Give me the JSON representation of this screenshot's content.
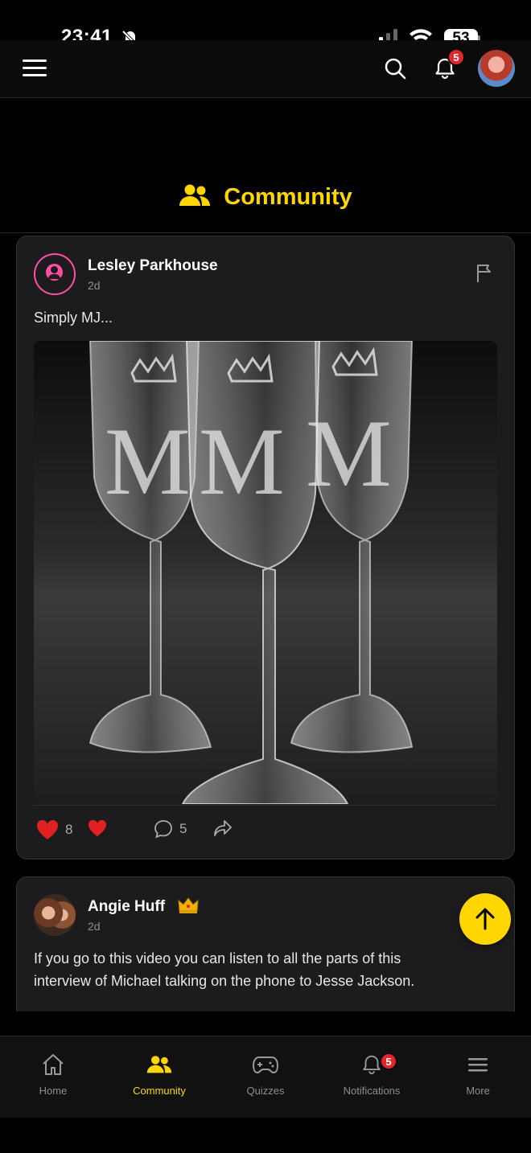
{
  "status_bar": {
    "time": "23:41",
    "battery": "53"
  },
  "header": {
    "notification_count": "5",
    "icons": [
      "menu-icon",
      "search-icon",
      "bell-icon",
      "avatar"
    ]
  },
  "page": {
    "title": "Community",
    "title_icon": "users-icon",
    "accent_color": "#ffd600"
  },
  "posts": [
    {
      "author": "Lesley Parkhouse",
      "time": "2d",
      "text": "Simply MJ...",
      "image_alt": "Three engraved champagne flutes with MJ monogram and crown",
      "reactions": {
        "likes": "8",
        "comments": "5"
      }
    },
    {
      "author": "Angie Huff",
      "time": "2d",
      "badge": "crown",
      "text_line1": "If you go to this video you can listen to all the parts of this",
      "text_line2": "interview of Michael talking on the phone to Jesse Jackson."
    }
  ],
  "bottom_nav": {
    "items": [
      {
        "label": "Home",
        "icon": "home-icon"
      },
      {
        "label": "Community",
        "icon": "users-icon",
        "active": true
      },
      {
        "label": "Quizzes",
        "icon": "gamepad-icon"
      },
      {
        "label": "Notifications",
        "icon": "bell-icon",
        "badge": "5"
      },
      {
        "label": "More",
        "icon": "menu-icon"
      }
    ]
  }
}
